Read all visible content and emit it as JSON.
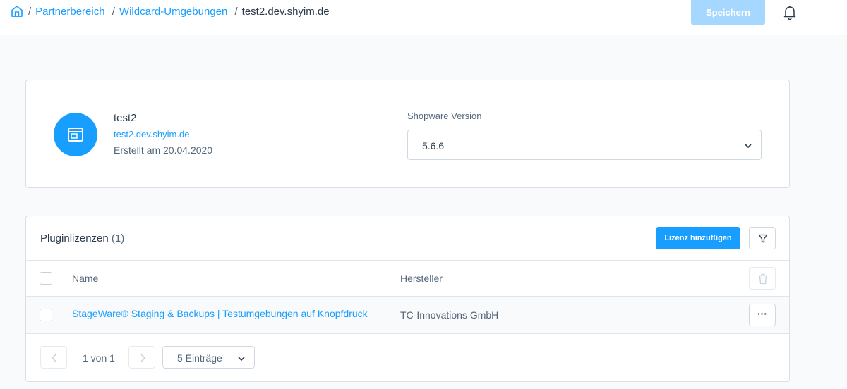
{
  "breadcrumb": {
    "home_icon": "home-icon",
    "items": [
      "Partnerbereich",
      "Wildcard-Umgebungen"
    ],
    "current": "test2.dev.shyim.de"
  },
  "toolbar": {
    "save_label": "Speichern",
    "bell_icon": "bell-icon"
  },
  "environment": {
    "name": "test2",
    "domain": "test2.dev.shyim.de",
    "created": "Erstellt am 20.04.2020",
    "version_label": "Shopware Version",
    "version_value": "5.6.6"
  },
  "plugins": {
    "title": "Pluginlizenzen",
    "count": "(1)",
    "add_label": "Lizenz hinzufügen",
    "columns": [
      "Name",
      "Hersteller"
    ],
    "rows": [
      {
        "name": "StageWare® Staging & Backups | Testumgebungen auf Knopfdruck",
        "vendor": "TC-Innovations GmbH"
      }
    ],
    "more_label": "···",
    "pagination": {
      "page_text": "1 von 1",
      "per_page": "5 Einträge"
    }
  },
  "colors": {
    "accent": "#189eff",
    "accent_disabled": "#a6d8ff"
  }
}
